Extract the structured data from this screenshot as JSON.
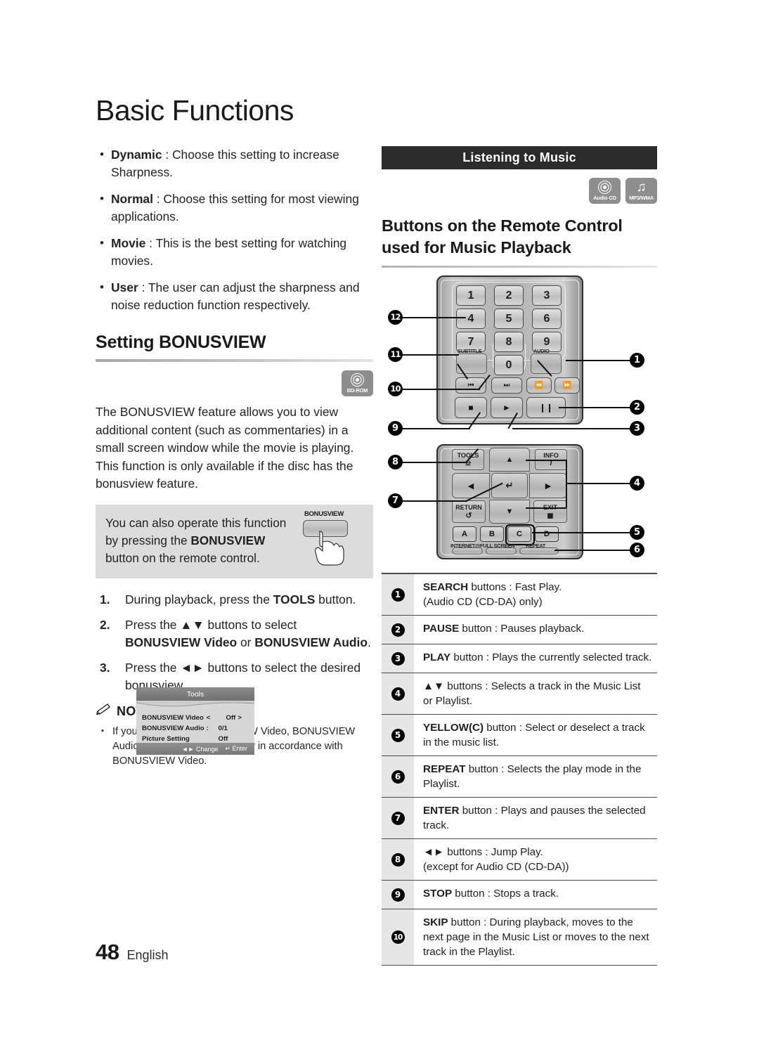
{
  "chapter": {
    "title": "Basic Functions"
  },
  "left": {
    "bullets": [
      {
        "term": "Dynamic",
        "rest": " : Choose this setting to increase Sharpness."
      },
      {
        "term": "Normal",
        "rest": " : Choose this setting for most viewing applications."
      },
      {
        "term": "Movie",
        "rest": " : This is the best setting for watching movies."
      },
      {
        "term": "User",
        "rest": " : The user can adjust the sharpness and noise reduction function respectively."
      }
    ],
    "section_heading": "Setting BONUSVIEW",
    "disc_badge": {
      "icon": "bd-rom-disc-icon",
      "caption": "BD-ROM"
    },
    "paragraph": "The BONUSVIEW feature allows you to view additional content (such as commentaries) in a small screen window while the movie is playing. This function is only available if the disc has the bonusview feature.",
    "tip": {
      "text_before": "You can also operate this function by pressing the ",
      "bold": "BONUSVIEW",
      "text_after": " button on the remote control.",
      "button_label": "BONUSVIEW"
    },
    "steps": [
      {
        "num": "1.",
        "before": "During playback, press the ",
        "bold": "TOOLS",
        "after": " button."
      },
      {
        "num": "2.",
        "before": "Press the ▲▼ buttons to select ",
        "bold": "BONUSVIEW Video",
        "mid": " or ",
        "bold2": "BONUSVIEW Audio",
        "after": "."
      },
      {
        "num": "3.",
        "before": "Press the ◄► buttons to select the desired bonusview.",
        "bold": "",
        "after": ""
      }
    ],
    "note": {
      "icon": "pencil-note-icon",
      "title": "NOTE",
      "items": [
        "If you switch from BONUSVIEW Video, BONUSVIEW Audio will change automatically in accordance with BONUSVIEW Video."
      ]
    },
    "osd": {
      "title": "Tools",
      "rows": [
        {
          "label": "BONUSVIEW Video",
          "left_arrow": "<",
          "value": "Off",
          "right_arrow": ">"
        },
        {
          "label": "BONUSVIEW Audio :",
          "left_arrow": "",
          "value": "0/1 Off",
          "right_arrow": ""
        },
        {
          "label": "Picture Setting",
          "left_arrow": "",
          "value": "",
          "right_arrow": ""
        }
      ],
      "footer": [
        {
          "icon": "◄►",
          "label": "Change"
        },
        {
          "icon": "↵",
          "label": "Enter"
        }
      ]
    }
  },
  "right": {
    "band_title": "Listening to Music",
    "disc_badges": [
      {
        "icon": "audio-cd-disc-icon",
        "caption": "Audio CD"
      },
      {
        "icon": "music-note-icon",
        "caption": "MP3/WMA"
      }
    ],
    "sub_heading": "Buttons on the Remote Control used for Music Playback",
    "remote": {
      "numpad": [
        "1",
        "2",
        "3",
        "4",
        "5",
        "6",
        "7",
        "8",
        "9",
        "0"
      ],
      "labels": {
        "subtitle": "SUBTITLE",
        "audio": "AUDIO",
        "tools": "TOOLS",
        "info": "INFO",
        "return": "RETURN",
        "exit": "EXIT",
        "internet": "INTERNET@",
        "fullscreen": "FULL SCREEN",
        "repeat": "REPEAT"
      },
      "color_keys": [
        "A",
        "B",
        "C",
        "D"
      ],
      "callouts": [
        "1",
        "2",
        "3",
        "4",
        "5",
        "6",
        "7",
        "8",
        "9",
        "10",
        "11",
        "12"
      ]
    },
    "legend": [
      {
        "num": "1",
        "bold": "SEARCH",
        "text": " buttons : Fast Play.\n(Audio CD (CD-DA) only)"
      },
      {
        "num": "2",
        "bold": "PAUSE",
        "text": " button : Pauses playback."
      },
      {
        "num": "3",
        "bold": "PLAY",
        "text": " button : Plays the currently selected track."
      },
      {
        "num": "4",
        "bold": "▲▼",
        "text": " buttons : Selects a track in the Music List or Playlist."
      },
      {
        "num": "5",
        "bold": "YELLOW(C)",
        "text": " button : Select or deselect a track in the music list."
      },
      {
        "num": "6",
        "bold": "REPEAT",
        "text": " button : Selects the play mode in the Playlist."
      },
      {
        "num": "7",
        "bold": "ENTER",
        "text": " button : Plays and pauses the selected track."
      },
      {
        "num": "8",
        "bold": "◄►",
        "text": " buttons : Jump Play.\n(except for Audio CD (CD-DA))"
      },
      {
        "num": "9",
        "bold": "STOP",
        "text": " button : Stops a track."
      },
      {
        "num": "10",
        "bold": "SKIP",
        "text": " button : During playback, moves to the next page in the Music List or moves to the next track in the Playlist."
      }
    ]
  },
  "footer": {
    "page_number": "48",
    "language": "English"
  }
}
